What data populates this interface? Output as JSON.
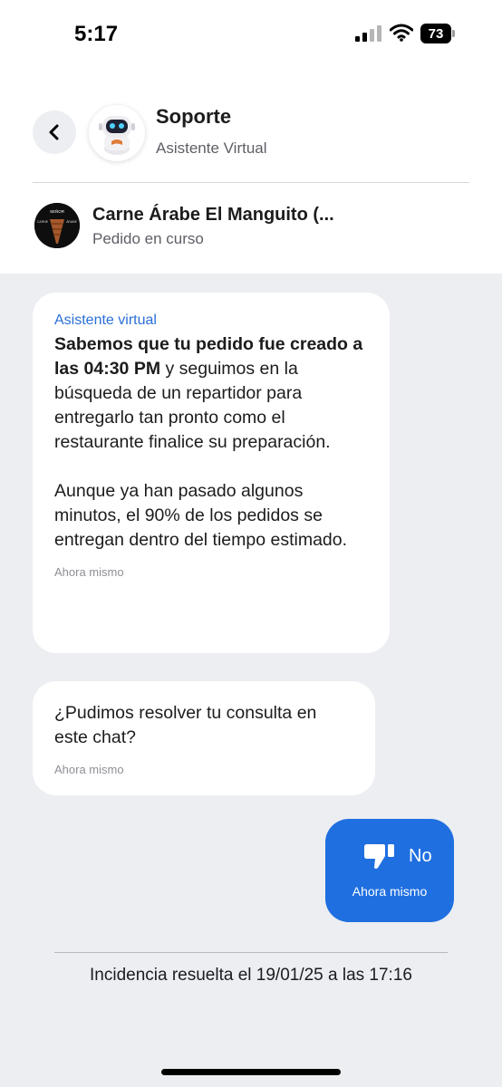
{
  "status_bar": {
    "time": "5:17",
    "battery": "73"
  },
  "header": {
    "title": "Soporte",
    "subtitle": "Asistente Virtual"
  },
  "order": {
    "store_name": "Carne Árabe El Manguito (...",
    "status": "Pedido en curso"
  },
  "messages": [
    {
      "sender": "Asistente virtual",
      "bold_text": "Sabemos que tu pedido fue creado a las 04:30 PM",
      "text_after_bold": " y seguimos en la búsqueda de un repartidor para entregarlo tan pronto como el restaurante finalice su preparación.",
      "paragraph_2": "Aunque ya han pasado algunos minutos, el 90% de los pedidos se entregan dentro del tiempo estimado.",
      "time": "Ahora mismo"
    },
    {
      "text": "¿Pudimos resolver tu consulta en este chat?",
      "time": "Ahora mismo"
    }
  ],
  "reply": {
    "label": "No",
    "time": "Ahora mismo",
    "icon": "thumbs-down-icon"
  },
  "footer": {
    "resolved_text": "Incidencia resuelta el 19/01/25 a las 17:16"
  },
  "colors": {
    "accent": "#1f6fe0",
    "sender_label": "#2a6fd8",
    "background": "#eceef2"
  }
}
